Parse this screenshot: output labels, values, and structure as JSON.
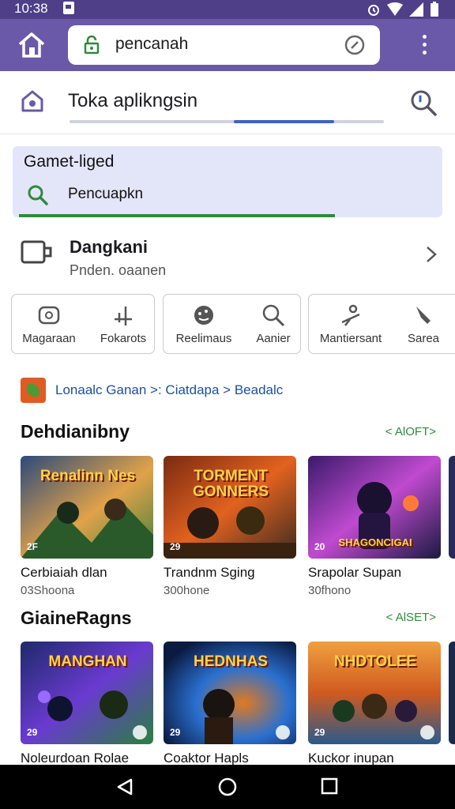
{
  "status_bar": {
    "time": "10:38"
  },
  "browser": {
    "url": "pencanah"
  },
  "store": {
    "title": "Toka aplikngsin",
    "progress": 0.32
  },
  "filter": {
    "title": "Gamet-liged",
    "query": "Pencuapkn"
  },
  "download": {
    "title": "Dangkani",
    "subtitle": "Pnden. oaanen"
  },
  "categories": [
    {
      "label": "Magaraan",
      "icon": "controller-icon"
    },
    {
      "label": "Fokarots",
      "icon": "arrows-icon"
    },
    {
      "label": "Reelimaus",
      "icon": "palette-icon"
    },
    {
      "label": "Aanier",
      "icon": "search-icon"
    },
    {
      "label": "Mantiersant",
      "icon": "lever-icon"
    },
    {
      "label": "Sarea",
      "icon": "puzzle-icon"
    }
  ],
  "breadcrumb": {
    "text": "Lonaalc Ganan >: Ciatdapa > Beadalc"
  },
  "sections": [
    {
      "title": "Dehdianibny",
      "link": "< AlOFT>",
      "cards": [
        {
          "art_caption": "Renalinn Nes",
          "badge": "2F",
          "title": "Cerbiaiah dlan",
          "subtitle": "03Shoona",
          "colors": [
            "#3f7f3a",
            "#e0a24a",
            "#2c4a7a"
          ]
        },
        {
          "art_caption": "TORMENT GONNERS",
          "badge": "29",
          "title": "Trandnm Sging",
          "subtitle": "300hone",
          "colors": [
            "#7a2a12",
            "#e2621f",
            "#3a2a20"
          ]
        },
        {
          "art_caption": "SHAGONCIGAI",
          "badge": "20",
          "title": "Srapolar Supan",
          "subtitle": "30fhono",
          "colors": [
            "#3a1a6a",
            "#c04ad0",
            "#1a1a40"
          ]
        }
      ]
    },
    {
      "title": "GiaineRagns",
      "link": "< AlSET>",
      "cards": [
        {
          "art_caption": "MANGHAN",
          "badge": "29",
          "title": "Noleurdoan Rolae",
          "subtitle": "",
          "colors": [
            "#1d2a6a",
            "#6a3ad0",
            "#2a8040"
          ]
        },
        {
          "art_caption": "HEDNHAS",
          "badge": "29",
          "title": "Coaktor Hapls",
          "subtitle": "",
          "colors": [
            "#0a1a40",
            "#2a70d0",
            "#e07a20"
          ]
        },
        {
          "art_caption": "NHDTOLEE",
          "badge": "29",
          "title": "Kuckor inupan",
          "subtitle": "",
          "colors": [
            "#d05a20",
            "#f0a040",
            "#2a5a8a"
          ]
        }
      ]
    }
  ],
  "colors": {
    "toolbar": "#6a59a8",
    "status": "#4e3f88",
    "accent_green": "#2e8b3a",
    "link_blue": "#1e4fa0"
  }
}
